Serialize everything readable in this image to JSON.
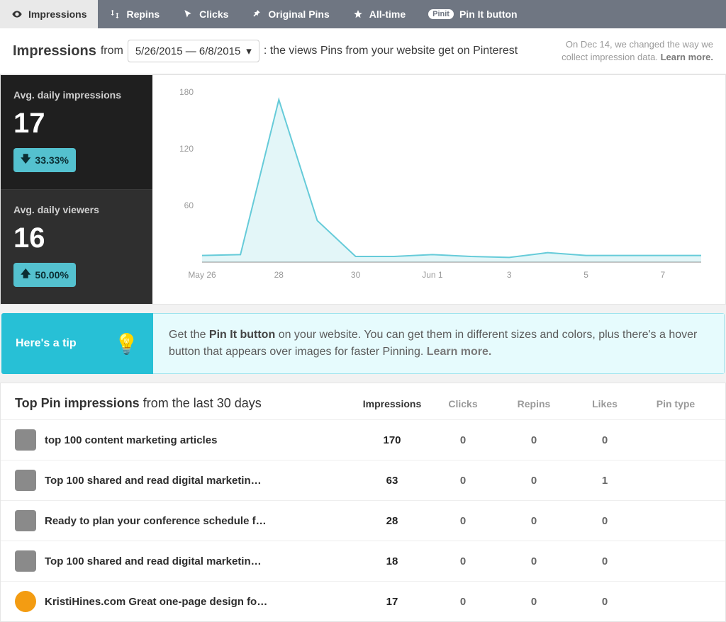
{
  "tabs": {
    "impressions": "Impressions",
    "repins": "Repins",
    "clicks": "Clicks",
    "original": "Original Pins",
    "alltime": "All-time",
    "pinit_badge": "Pinit",
    "pinit": "Pin It button"
  },
  "subhead": {
    "title": "Impressions",
    "from": "from",
    "range": "5/26/2015 — 6/8/2015",
    "desc": ": the views Pins from your website get on Pinterest",
    "notice1": "On Dec 14, we changed the way we",
    "notice2": "collect impression data. ",
    "learn": "Learn more."
  },
  "kpi": {
    "impress_label": "Avg. daily impressions",
    "impress_value": "17",
    "impress_delta": "33.33%",
    "viewers_label": "Avg. daily viewers",
    "viewers_value": "16",
    "viewers_delta": "50.00%"
  },
  "tip": {
    "heading": "Here's a tip",
    "t1": "Get the ",
    "bold": "Pin It button",
    "t2": " on your website. You can get them in different sizes and colors, plus there's a hover button that appears over images for faster Pinning. ",
    "learn": "Learn more."
  },
  "table": {
    "title_bold": "Top Pin impressions",
    "title_rest": " from the last 30 days",
    "h1": "Impressions",
    "h2": "Clicks",
    "h3": "Repins",
    "h4": "Likes",
    "h5": "Pin type",
    "rows": [
      {
        "title": "top 100 content marketing articles",
        "c1": "170",
        "c2": "0",
        "c3": "0",
        "c4": "0",
        "c5": ""
      },
      {
        "title": "Top 100 shared and read digital marketin…",
        "c1": "63",
        "c2": "0",
        "c3": "0",
        "c4": "1",
        "c5": ""
      },
      {
        "title": "Ready to plan your conference schedule f…",
        "c1": "28",
        "c2": "0",
        "c3": "0",
        "c4": "0",
        "c5": ""
      },
      {
        "title": "Top 100 shared and read digital marketin…",
        "c1": "18",
        "c2": "0",
        "c3": "0",
        "c4": "0",
        "c5": ""
      },
      {
        "title": "KristiHines.com Great one-page design fo…",
        "c1": "17",
        "c2": "0",
        "c3": "0",
        "c4": "0",
        "c5": ""
      }
    ]
  },
  "chart_data": {
    "type": "line",
    "title": "Impressions",
    "xlabel": "",
    "ylabel": "",
    "ylim": [
      0,
      180
    ],
    "yticks": [
      60,
      120,
      180
    ],
    "x": [
      "May 26",
      "27",
      "28",
      "29",
      "30",
      "31",
      "Jun 1",
      "2",
      "3",
      "4",
      "5",
      "6",
      "7",
      "8"
    ],
    "xticks_shown": [
      "May 26",
      "28",
      "30",
      "Jun 1",
      "3",
      "5",
      "7"
    ],
    "values": [
      7,
      8,
      172,
      44,
      6,
      6,
      8,
      6,
      5,
      10,
      7,
      7,
      7,
      7
    ]
  }
}
